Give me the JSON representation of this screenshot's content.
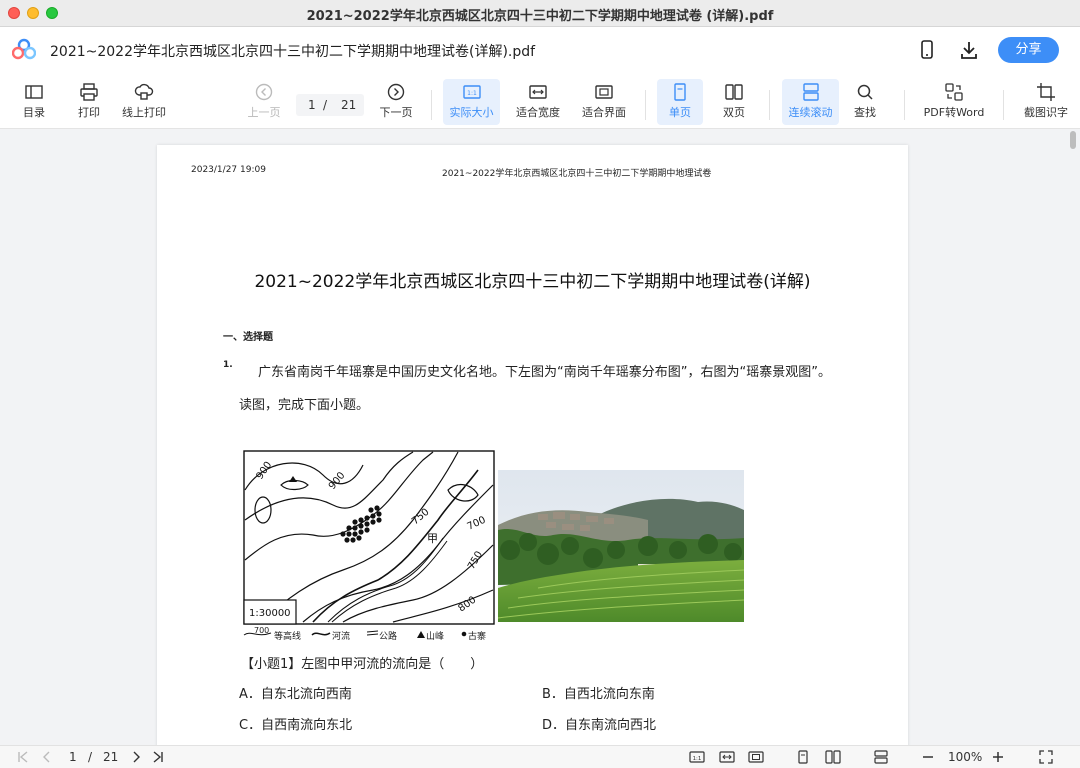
{
  "window": {
    "title": "2021~2022学年北京西城区北京四十三中初二下学期期中地理试卷 (详解).pdf"
  },
  "header": {
    "doc_name": "2021~2022学年北京西城区北京四十三中初二下学期期中地理试卷(详解).pdf",
    "share_label": "分享"
  },
  "toolbar": {
    "toc": "目录",
    "print": "打印",
    "online_print": "线上打印",
    "prev": "上一页",
    "current_page": "1",
    "page_sep": "/",
    "total_pages": "21",
    "next": "下一页",
    "actual_size": "实际大小",
    "fit_width": "适合宽度",
    "fit_screen": "适合界面",
    "single_page": "单页",
    "double_page": "双页",
    "continuous": "连续滚动",
    "find": "查找",
    "pdf_to_word": "PDF转Word",
    "ocr": "截图识字"
  },
  "page": {
    "timestamp": "2023/1/27 19:09",
    "running_header": "2021~2022学年北京西城区北京四十三中初二下学期期中地理试卷",
    "title": "2021~2022学年北京西城区北京四十三中初二下学期期中地理试卷(详解)",
    "section": "一、选择题",
    "q_number": "1.",
    "q_line1": "广东省南岗千年瑶寨是中国历史文化名地。下左图为“南岗千年瑶寨分布图”，右图为“瑶寨景观图”。",
    "q_line2": "读图，完成下面小题。",
    "map": {
      "labels": [
        "900",
        "900",
        "750",
        "700",
        "750",
        "800",
        "甲"
      ],
      "scale": "1:30000",
      "legend": {
        "contour_sample": "700",
        "contour": "等高线",
        "river": "河流",
        "road": "公路",
        "peak": "山峰",
        "village": "古寨"
      }
    },
    "sub_question": "【小题1】左图中甲河流的流向是（　　）",
    "options": {
      "a": "A．自东北流向西南",
      "b": "B．自西北流向东南",
      "c": "C．自西南流向东北",
      "d": "D．自东南流向西北"
    }
  },
  "statusbar": {
    "current_page": "1",
    "sep": "/",
    "total_pages": "21",
    "zoom": "100%"
  }
}
